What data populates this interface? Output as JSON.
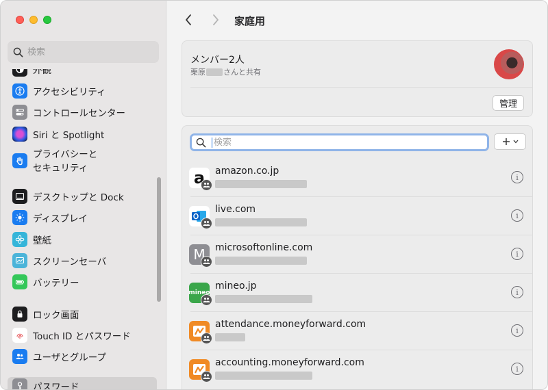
{
  "sidebar": {
    "search_placeholder": "検索",
    "items": [
      {
        "label": "外観"
      },
      {
        "label": "アクセシビリティ"
      },
      {
        "label": "コントロールセンター"
      },
      {
        "label": "Siri と Spotlight"
      },
      {
        "label_line1": "プライバシーと",
        "label_line2": "セキュリティ"
      },
      {
        "label": "デスクトップと Dock"
      },
      {
        "label": "ディスプレイ"
      },
      {
        "label": "壁紙"
      },
      {
        "label": "スクリーンセーバ"
      },
      {
        "label": "バッテリー"
      },
      {
        "label": "ロック画面"
      },
      {
        "label": "Touch ID とパスワード"
      },
      {
        "label": "ユーザとグループ"
      },
      {
        "label": "パスワード"
      }
    ]
  },
  "header": {
    "title": "家庭用"
  },
  "group": {
    "members_title": "メンバー2人",
    "shared_prefix": "栗原",
    "shared_suffix": "さんと共有",
    "manage_label": "管理"
  },
  "passwords": {
    "search_placeholder": "検索",
    "rows": [
      {
        "site": "amazon.co.jp",
        "icon": "amazon-icon"
      },
      {
        "site": "live.com",
        "icon": "outlook-icon"
      },
      {
        "site": "microsoftonline.com",
        "icon": "m-letter-icon"
      },
      {
        "site": "mineo.jp",
        "icon": "mineo-icon"
      },
      {
        "site": "attendance.moneyforward.com",
        "icon": "moneyforward-icon"
      },
      {
        "site": "accounting.moneyforward.com",
        "icon": "moneyforward-icon"
      }
    ]
  },
  "colors": {
    "accent": "#2a7ae2",
    "focus_ring": "#8fb4e8",
    "sidebar_bg": "#e8e6e6"
  }
}
